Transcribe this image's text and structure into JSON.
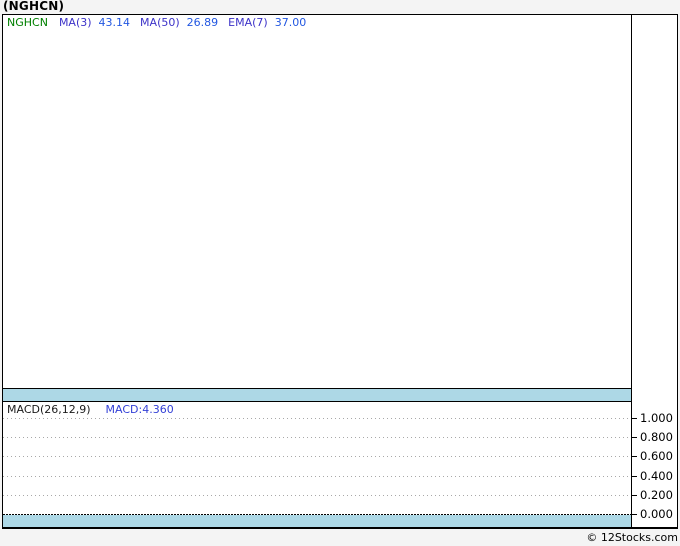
{
  "title": "(NGHCN)",
  "main_panel": {
    "legend": {
      "symbol": "NGHCN",
      "indicators": [
        {
          "label": "MA(3)",
          "value": "43.14"
        },
        {
          "label": "MA(50)",
          "value": "26.89"
        },
        {
          "label": "EMA(7)",
          "value": "37.00"
        }
      ]
    }
  },
  "macd_panel": {
    "legend": {
      "label": "MACD(26,12,9)",
      "value": "MACD:4.360"
    },
    "axis_ticks": [
      "1.000",
      "0.800",
      "0.600",
      "0.400",
      "0.200",
      "0.000"
    ]
  },
  "footer": {
    "copyright": "© 12Stocks.com"
  },
  "colors": {
    "symbol_green": "#008000",
    "indicator_label_blue": "#3c32c8",
    "indicator_value_blue": "#2257e1",
    "macd_value_blue": "#3340d6",
    "separator_band_blue": "#add8e6",
    "gridline_gray": "#a8a8a8",
    "background_gray": "#f4f4f4"
  },
  "chart_data": [
    {
      "type": "line",
      "title": "(NGHCN)",
      "series": [
        {
          "name": "NGHCN",
          "visible_points": []
        },
        {
          "name": "MA(3)",
          "last_value": 43.14
        },
        {
          "name": "MA(50)",
          "last_value": 26.89
        },
        {
          "name": "EMA(7)",
          "last_value": 37.0
        }
      ],
      "legend_position": "top-left",
      "grid": false,
      "note": "price panel plot area is empty - no series pixels rendered"
    },
    {
      "type": "line",
      "title": "MACD(26,12,9)",
      "series": [
        {
          "name": "MACD",
          "last_value": 4.36,
          "visible_points": []
        }
      ],
      "yticks": [
        1.0,
        0.8,
        0.6,
        0.4,
        0.2,
        0.0
      ],
      "ylim": [
        -0.07,
        1.1
      ],
      "grid": true,
      "legend_position": "top-left",
      "note": "MACD panel shows horizontal dotted gridlines and zero line only - no plotted curve visible"
    }
  ]
}
